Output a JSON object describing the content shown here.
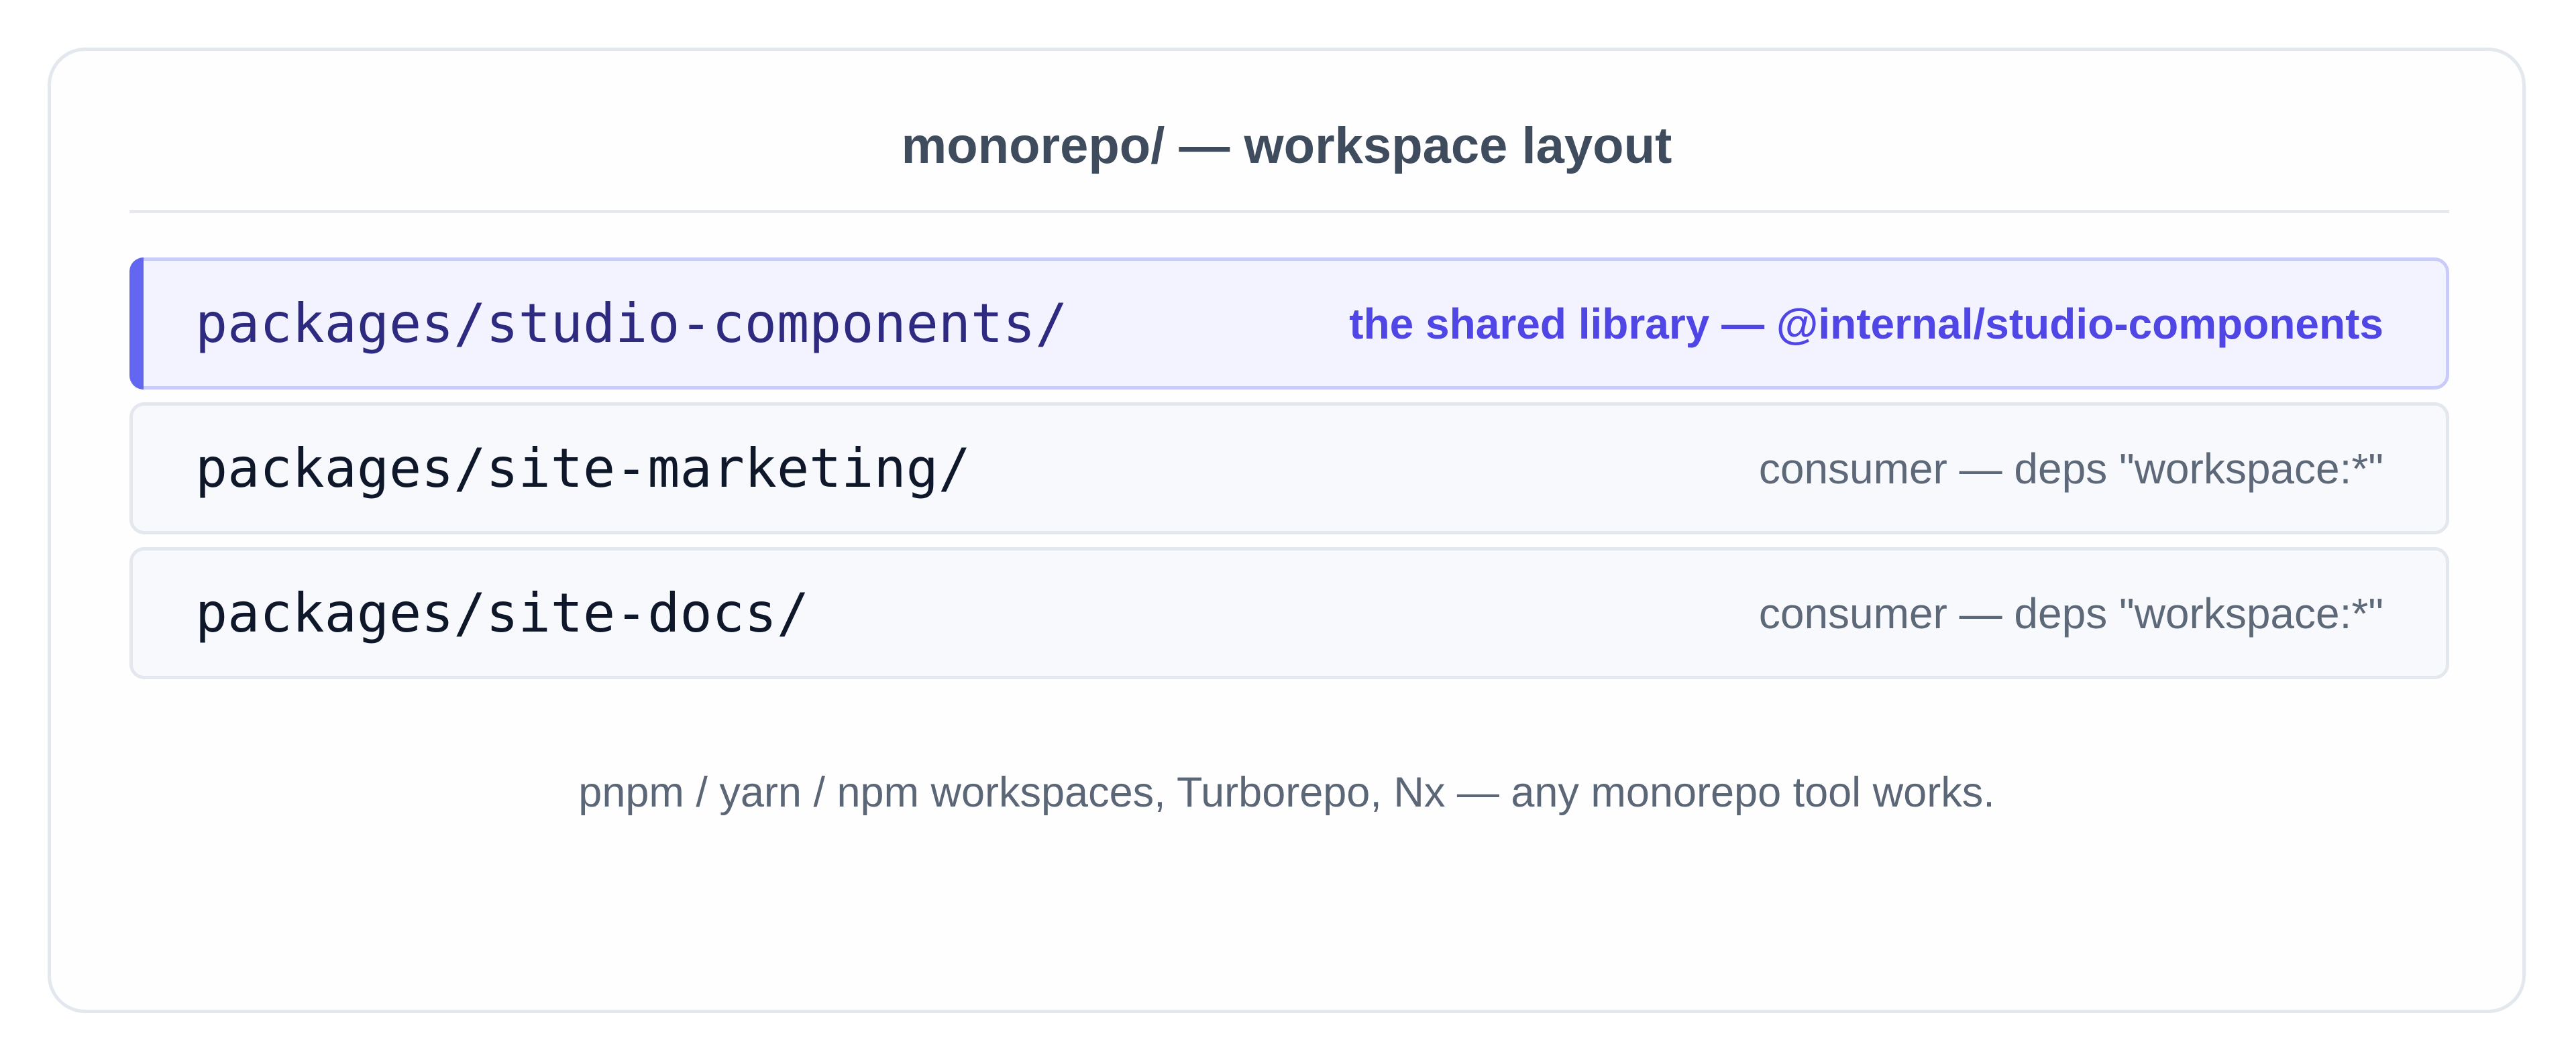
{
  "title": "monorepo/ — workspace layout",
  "colors": {
    "accent": "#6366f1",
    "highlight_text": "#4f46e5",
    "highlight_bg": "#f3f2ff",
    "row_bg": "#f7f9fc",
    "border": "#e3e8ef"
  },
  "packages": [
    {
      "path": "packages/studio-components/",
      "note": "the shared library — @internal/studio-components",
      "highlighted": true
    },
    {
      "path": "packages/site-marketing/",
      "note": "consumer — deps \"workspace:*\"",
      "highlighted": false
    },
    {
      "path": "packages/site-docs/",
      "note": "consumer — deps \"workspace:*\"",
      "highlighted": false
    }
  ],
  "footer": "pnpm / yarn / npm workspaces, Turborepo, Nx — any monorepo tool works."
}
